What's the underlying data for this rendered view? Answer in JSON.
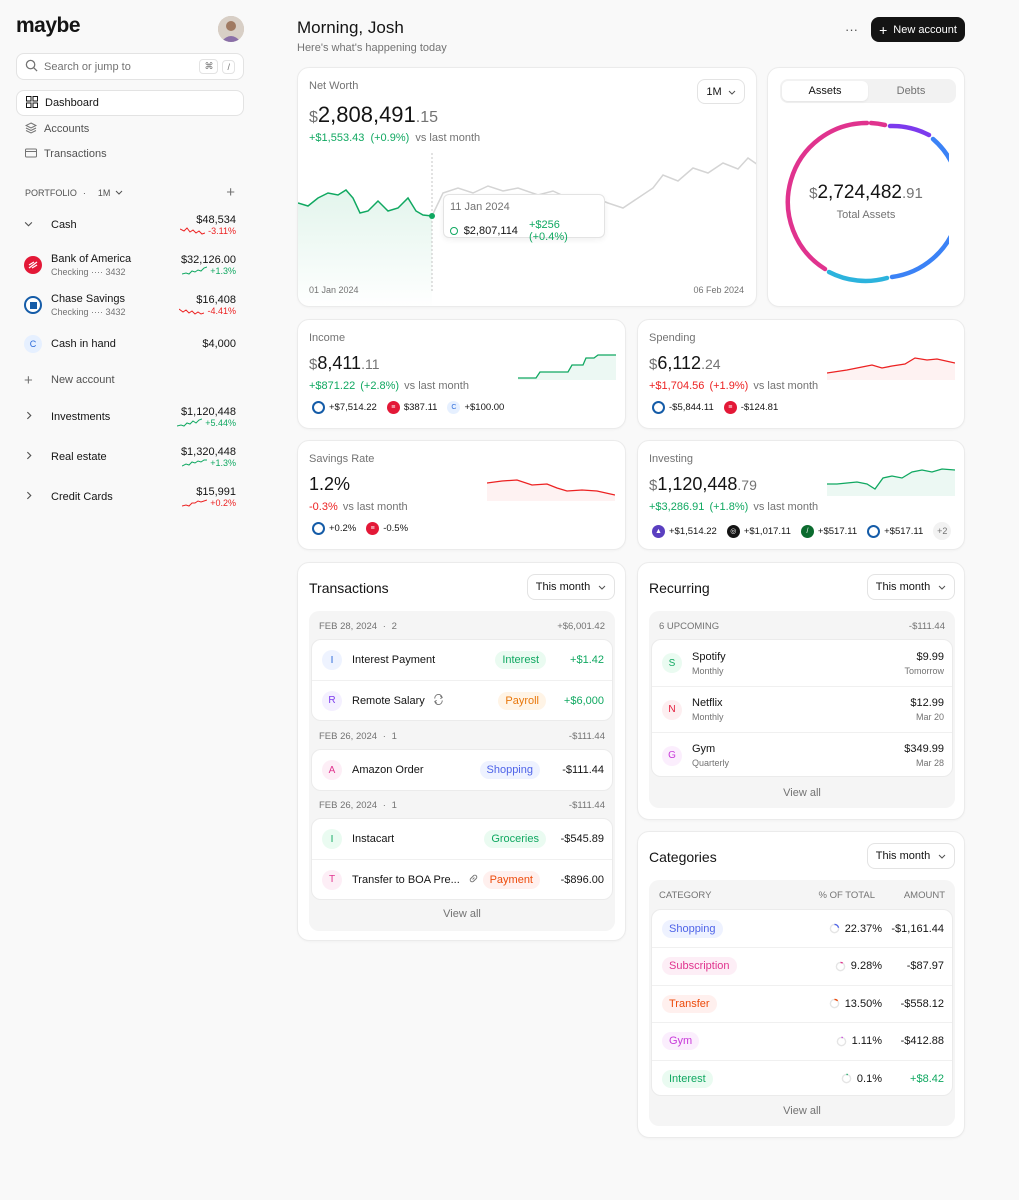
{
  "app": {
    "logo": "maybe"
  },
  "search": {
    "placeholder": "Search or jump to",
    "kbd1": "⌘",
    "kbd2": "/"
  },
  "nav": [
    {
      "label": "Dashboard"
    },
    {
      "label": "Accounts"
    },
    {
      "label": "Transactions"
    }
  ],
  "portfolio": {
    "label": "PORTFOLIO",
    "sep": "·",
    "period": "1M"
  },
  "accounts": {
    "cash": {
      "label": "Cash",
      "value": "$48,534",
      "change": "-3.11%"
    },
    "boa": {
      "name": "Bank of America",
      "sub": "Checking ···· 3432",
      "value": "$32,126.00",
      "change": "+1.3%"
    },
    "chase": {
      "name": "Chase Savings",
      "sub": "Checking ···· 3432",
      "value": "$16,408",
      "change": "-4.41%"
    },
    "cashhand": {
      "name": "Cash in hand",
      "letter": "C",
      "value": "$4,000"
    },
    "new_account": "New account",
    "investments": {
      "label": "Investments",
      "value": "$1,120,448",
      "change": "+5.44%"
    },
    "realestate": {
      "label": "Real estate",
      "value": "$1,320,448",
      "change": "+1.3%"
    },
    "credit": {
      "label": "Credit Cards",
      "value": "$15,991",
      "change": "+0.2%"
    }
  },
  "header": {
    "greeting": "Morning, Josh",
    "subtitle": "Here's what's happening today",
    "more": "···",
    "new_account": "New account"
  },
  "networth": {
    "title": "Net Worth",
    "currency": "$",
    "whole": "2,808,491",
    "decimal": ".15",
    "change": "+$1,553.43",
    "change_pct": "(+0.9%)",
    "vs": "vs last month",
    "period": "1M",
    "tooltip": {
      "date": "11 Jan 2024",
      "value": "$2,807,114",
      "change": "+$256 (+0.4%)"
    },
    "start_date": "01 Jan 2024",
    "end_date": "06 Feb 2024"
  },
  "assets": {
    "tab_assets": "Assets",
    "tab_debts": "Debts",
    "currency": "$",
    "whole": "2,724,482",
    "decimal": ".91",
    "label": "Total Assets"
  },
  "income": {
    "title": "Income",
    "currency": "$",
    "whole": "8,411",
    "decimal": ".11",
    "change": "+$871.22",
    "pct": "(+2.8%)",
    "vs": "vs last month",
    "chips": [
      "+$7,514.22",
      "$387.11",
      "+$100.00"
    ],
    "chip3_letter": "C"
  },
  "spending": {
    "title": "Spending",
    "currency": "$",
    "whole": "6,112",
    "decimal": ".24",
    "change": "+$1,704.56",
    "pct": "(+1.9%)",
    "vs": "vs last month",
    "chips": [
      "-$5,844.11",
      "-$124.81"
    ]
  },
  "savings": {
    "title": "Savings Rate",
    "value": "1.2%",
    "change": "-0.3%",
    "vs": "vs last month",
    "chips": [
      "+0.2%",
      "-0.5%"
    ]
  },
  "investing": {
    "title": "Investing",
    "currency": "$",
    "whole": "1,120,448",
    "decimal": ".79",
    "change": "+$3,286.91",
    "pct": "(+1.8%)",
    "vs": "vs last month",
    "chips": [
      "+$1,514.22",
      "+$1,017.11",
      "+$517.11",
      "+$517.11"
    ],
    "more": "+2"
  },
  "transactions": {
    "title": "Transactions",
    "period": "This month",
    "groups": [
      {
        "date": "FEB 28, 2024",
        "sep": "·",
        "count": "2",
        "total": "+$6,001.42"
      },
      {
        "date": "FEB 26, 2024",
        "sep": "·",
        "count": "1",
        "total": "-$111.44"
      },
      {
        "date": "FEB 26, 2024",
        "sep": "·",
        "count": "1",
        "total": "-$111.44"
      }
    ],
    "rows": [
      {
        "letter": "I",
        "name": "Interest Payment",
        "tag": "Interest",
        "amount": "+$1.42"
      },
      {
        "letter": "R",
        "name": "Remote Salary",
        "tag": "Payroll",
        "amount": "+$6,000"
      },
      {
        "letter": "A",
        "name": "Amazon Order",
        "tag": "Shopping",
        "amount": "-$111.44"
      },
      {
        "letter": "I",
        "name": "Instacart",
        "tag": "Groceries",
        "amount": "-$545.89"
      },
      {
        "letter": "T",
        "name": "Transfer to BOA Pre...",
        "tag": "Payment",
        "amount": "-$896.00"
      }
    ],
    "view_all": "View all"
  },
  "recurring": {
    "title": "Recurring",
    "period": "This month",
    "upcoming": "6 UPCOMING",
    "total": "-$111.44",
    "rows": [
      {
        "letter": "S",
        "name": "Spotify",
        "freq": "Monthly",
        "amount": "$9.99",
        "when": "Tomorrow"
      },
      {
        "letter": "N",
        "name": "Netflix",
        "freq": "Monthly",
        "amount": "$12.99",
        "when": "Mar 20"
      },
      {
        "letter": "G",
        "name": "Gym",
        "freq": "Quarterly",
        "amount": "$349.99",
        "when": "Mar 28"
      }
    ],
    "view_all": "View all"
  },
  "categories": {
    "title": "Categories",
    "period": "This month",
    "col_category": "CATEGORY",
    "col_pct": "% OF TOTAL",
    "col_amount": "AMOUNT",
    "rows": [
      {
        "name": "Shopping",
        "pct": "22.37%",
        "amount": "-$1,161.44",
        "color": "#4e63e8"
      },
      {
        "name": "Subscription",
        "pct": "9.28%",
        "amount": "-$87.97",
        "color": "#e0338e"
      },
      {
        "name": "Transfer",
        "pct": "13.50%",
        "amount": "-$558.12",
        "color": "#ec4a0a"
      },
      {
        "name": "Gym",
        "pct": "1.11%",
        "amount": "-$412.88",
        "color": "#c839d9"
      },
      {
        "name": "Interest",
        "pct": "0.1%",
        "amount": "+$8.42",
        "color": "#10a861"
      }
    ],
    "view_all": "View all"
  }
}
